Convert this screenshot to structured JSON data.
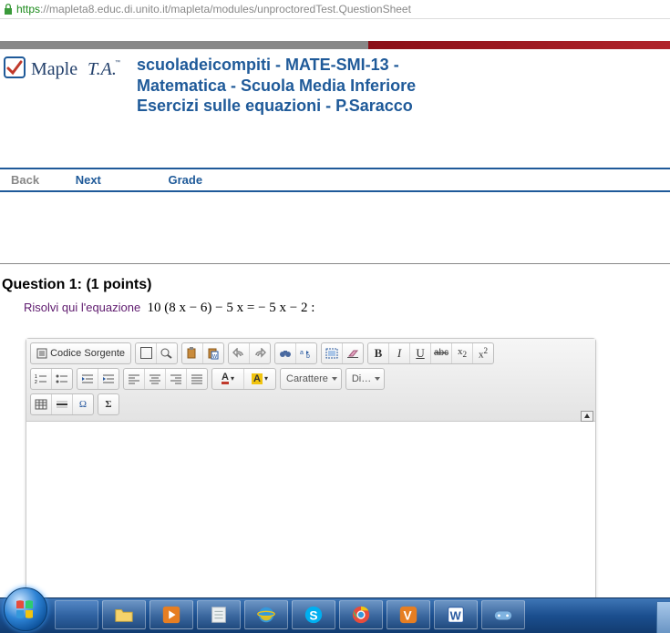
{
  "url": {
    "https": "https",
    "rest": "://mapleta8.educ.di.unito.it/mapleta/modules/unproctoredTest.QuestionSheet"
  },
  "logo": {
    "brand_a": "Maple",
    "brand_b": "T.A."
  },
  "title": {
    "line1": "scuoladeicompiti - MATE-SMI-13 -",
    "line2": "Matematica - Scuola Media Inferiore",
    "line3": "Esercizi sulle equazioni - P.Saracco"
  },
  "nav": {
    "back": "Back",
    "next": "Next",
    "grade": "Grade"
  },
  "question": {
    "heading": "Question 1: (1 points)",
    "prompt_label": "Risolvi qui l'equazione",
    "equation": "10 (8 x − 6) − 5 x = − 5 x − 2 :"
  },
  "toolbar": {
    "source": "Codice Sorgente",
    "style_dd": "Carattere",
    "font_dd": "Di…",
    "bold": "B",
    "italic": "I",
    "underline": "U",
    "strike": "abc",
    "sub": "x",
    "sub_s": "2",
    "sup": "x",
    "sup_s": "2",
    "textcolor": "A",
    "bgcolor": "A",
    "sigma": "Σ",
    "omega": "Ω"
  },
  "colors": {
    "brand": "#1f5a99",
    "purple": "#5e1a6e"
  }
}
